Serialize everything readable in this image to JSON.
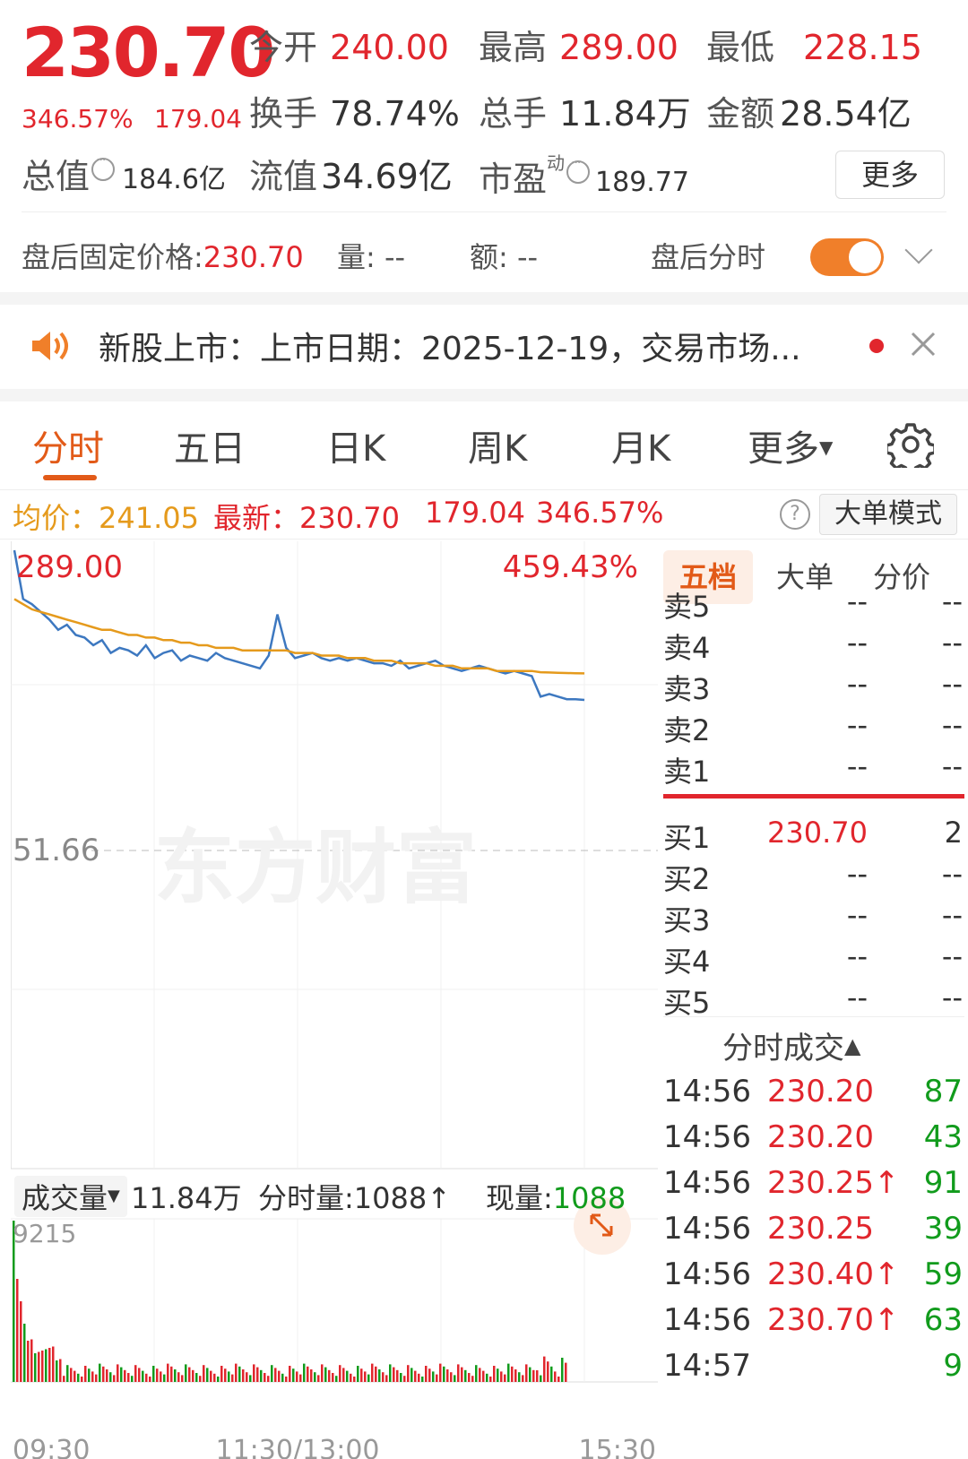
{
  "quote": {
    "price": "230.70",
    "change_pct": "346.57%",
    "change_amt": "179.04",
    "open_label": "今开",
    "open": "240.00",
    "high_label": "最高",
    "high": "289.00",
    "low_label": "最低",
    "low": "228.15",
    "turnover_label": "换手",
    "turnover": "78.74%",
    "volume_label": "总手",
    "volume": "11.84万",
    "amount_label": "金额",
    "amount": "28.54亿",
    "mcap_label": "总值",
    "mcap": "184.6亿",
    "float_label": "流值",
    "float": "34.69亿",
    "pe_label": "市盈",
    "pe_sup": "动",
    "pe": "189.77",
    "more_label": "更多"
  },
  "after_hours": {
    "price_label": "盘后固定价格:",
    "price": "230.70",
    "vol_label": "量:",
    "vol": "--",
    "amt_label": "额:",
    "amt": "--",
    "toggle_label": "盘后分时",
    "toggle_on": true
  },
  "notice": {
    "text": "新股上市：上市日期：2025-12-19，交易市场..."
  },
  "tabs": {
    "items": [
      "分时",
      "五日",
      "日K",
      "周K",
      "月K",
      "更多"
    ],
    "active": 0
  },
  "avg_row": {
    "avg_label": "均价：",
    "avg": "241.05",
    "latest_label": "最新：",
    "latest": "230.70",
    "chg": "179.04",
    "pct": "346.57%",
    "help": "?",
    "mode_label": "大单模式"
  },
  "chart": {
    "y_top": "289.00",
    "y_mid": "51.66",
    "pct_top": "459.43%",
    "watermark": "东方财富",
    "vol_label": "成交量",
    "vol_total": "11.84万",
    "minute_vol_label": "分时量:1088",
    "now_vol_label": "现量:",
    "now_vol": "1088",
    "vol_max": "9215",
    "x_labels": [
      "09:30",
      "11:30/13:00",
      "15:30"
    ]
  },
  "chart_data": {
    "type": "line",
    "series": [
      {
        "name": "",
        "values": [
          289.0,
          270,
          268,
          265,
          262,
          258,
          260,
          256,
          255,
          252,
          254,
          249,
          251,
          250,
          248,
          252,
          247,
          249,
          250,
          246,
          248,
          247,
          246,
          249,
          247,
          246,
          245,
          244,
          243,
          248,
          264,
          251,
          247,
          248,
          249,
          247,
          246,
          247,
          246,
          247,
          246,
          245,
          245,
          244,
          246,
          243,
          244,
          245,
          246,
          244,
          243,
          242,
          243,
          244,
          243,
          242,
          241,
          242,
          241,
          240,
          232,
          233,
          232,
          231,
          231,
          230.7
        ]
      },
      {
        "name": "",
        "values": [
          270,
          268,
          266,
          265,
          264,
          263,
          262,
          261,
          260,
          259,
          258,
          258,
          257,
          256,
          256,
          255,
          255,
          254,
          254,
          253,
          253,
          252,
          252,
          251,
          251,
          251,
          250,
          250,
          250,
          250,
          250,
          250,
          249,
          249,
          249,
          248,
          248,
          248,
          247,
          247,
          247,
          246,
          246,
          246,
          245,
          245,
          245,
          245,
          244,
          244,
          244,
          243,
          243,
          243,
          243,
          242,
          242,
          242,
          242,
          242,
          241.5,
          241.4,
          241.3,
          241.2,
          241.1,
          241.05
        ]
      }
    ],
    "ylim": [
      51.66,
      289.0
    ]
  },
  "panel": {
    "tabs": [
      "五档",
      "大单",
      "分价"
    ],
    "sells": [
      {
        "k": "卖5",
        "p": "--",
        "v": "--"
      },
      {
        "k": "卖4",
        "p": "--",
        "v": "--"
      },
      {
        "k": "卖3",
        "p": "--",
        "v": "--"
      },
      {
        "k": "卖2",
        "p": "--",
        "v": "--"
      },
      {
        "k": "卖1",
        "p": "--",
        "v": "--"
      }
    ],
    "buys": [
      {
        "k": "买1",
        "p": "230.70",
        "v": "2"
      },
      {
        "k": "买2",
        "p": "--",
        "v": "--"
      },
      {
        "k": "买3",
        "p": "--",
        "v": "--"
      },
      {
        "k": "买4",
        "p": "--",
        "v": "--"
      },
      {
        "k": "买5",
        "p": "--",
        "v": "--"
      }
    ],
    "ticks_label": "分时成交",
    "ticks": [
      {
        "t": "14:56",
        "p": "230.20",
        "v": "87"
      },
      {
        "t": "14:56",
        "p": "230.20",
        "v": "43"
      },
      {
        "t": "14:56",
        "p": "230.25↑",
        "v": "91"
      },
      {
        "t": "14:56",
        "p": "230.25",
        "v": "39"
      },
      {
        "t": "14:56",
        "p": "230.40↑",
        "v": "59"
      },
      {
        "t": "14:56",
        "p": "230.70↑",
        "v": "63"
      },
      {
        "t": "14:57",
        "p": "",
        "v": "9"
      }
    ]
  }
}
